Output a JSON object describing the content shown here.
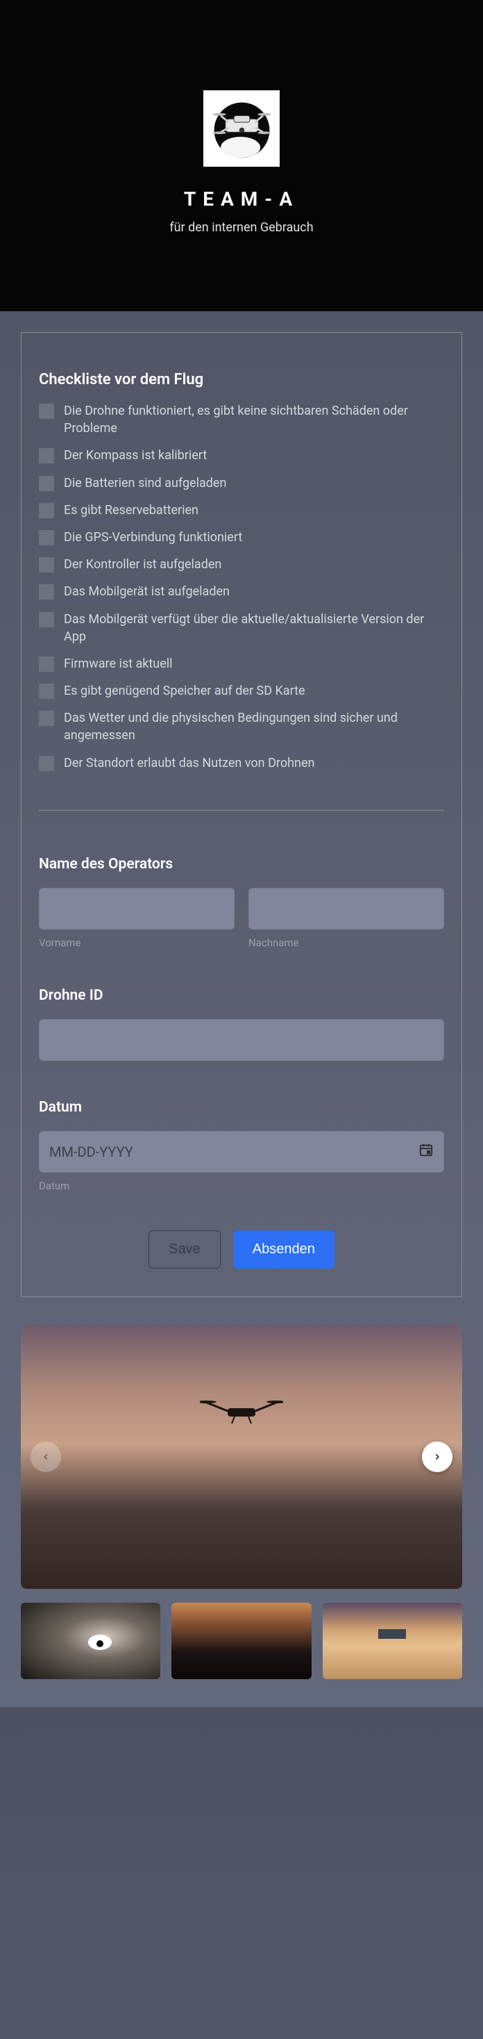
{
  "header": {
    "title": "TEAM-A",
    "subtitle": "für den internen Gebrauch"
  },
  "checklist": {
    "title": "Checkliste vor dem Flug",
    "items": [
      "Die Drohne funktioniert, es gibt keine sichtbaren Schäden oder Probleme",
      "Der Kompass ist kalibriert",
      "Die Batterien sind aufgeladen",
      "Es gibt Reservebatterien",
      "Die GPS-Verbindung funktioniert",
      "Der Kontroller ist aufgeladen",
      "Das Mobilgerät ist aufgeladen",
      "Das Mobilgerät verfügt über die aktuelle/aktualisierte Version der App",
      "Firmware ist aktuell",
      "Es gibt genügend Speicher auf der SD Karte",
      "Das Wetter und die physischen Bedingungen sind sicher und angemessen",
      "Der Standort erlaubt das Nutzen von Drohnen"
    ]
  },
  "form": {
    "operator": {
      "label": "Name des Operators",
      "first_sub": "Vorname",
      "last_sub": "Nachname"
    },
    "drone_id": {
      "label": "Drohne ID"
    },
    "date": {
      "label": "Datum",
      "placeholder": "MM-DD-YYYY",
      "sub": "Datum"
    },
    "buttons": {
      "save": "Save",
      "submit": "Absenden"
    }
  }
}
